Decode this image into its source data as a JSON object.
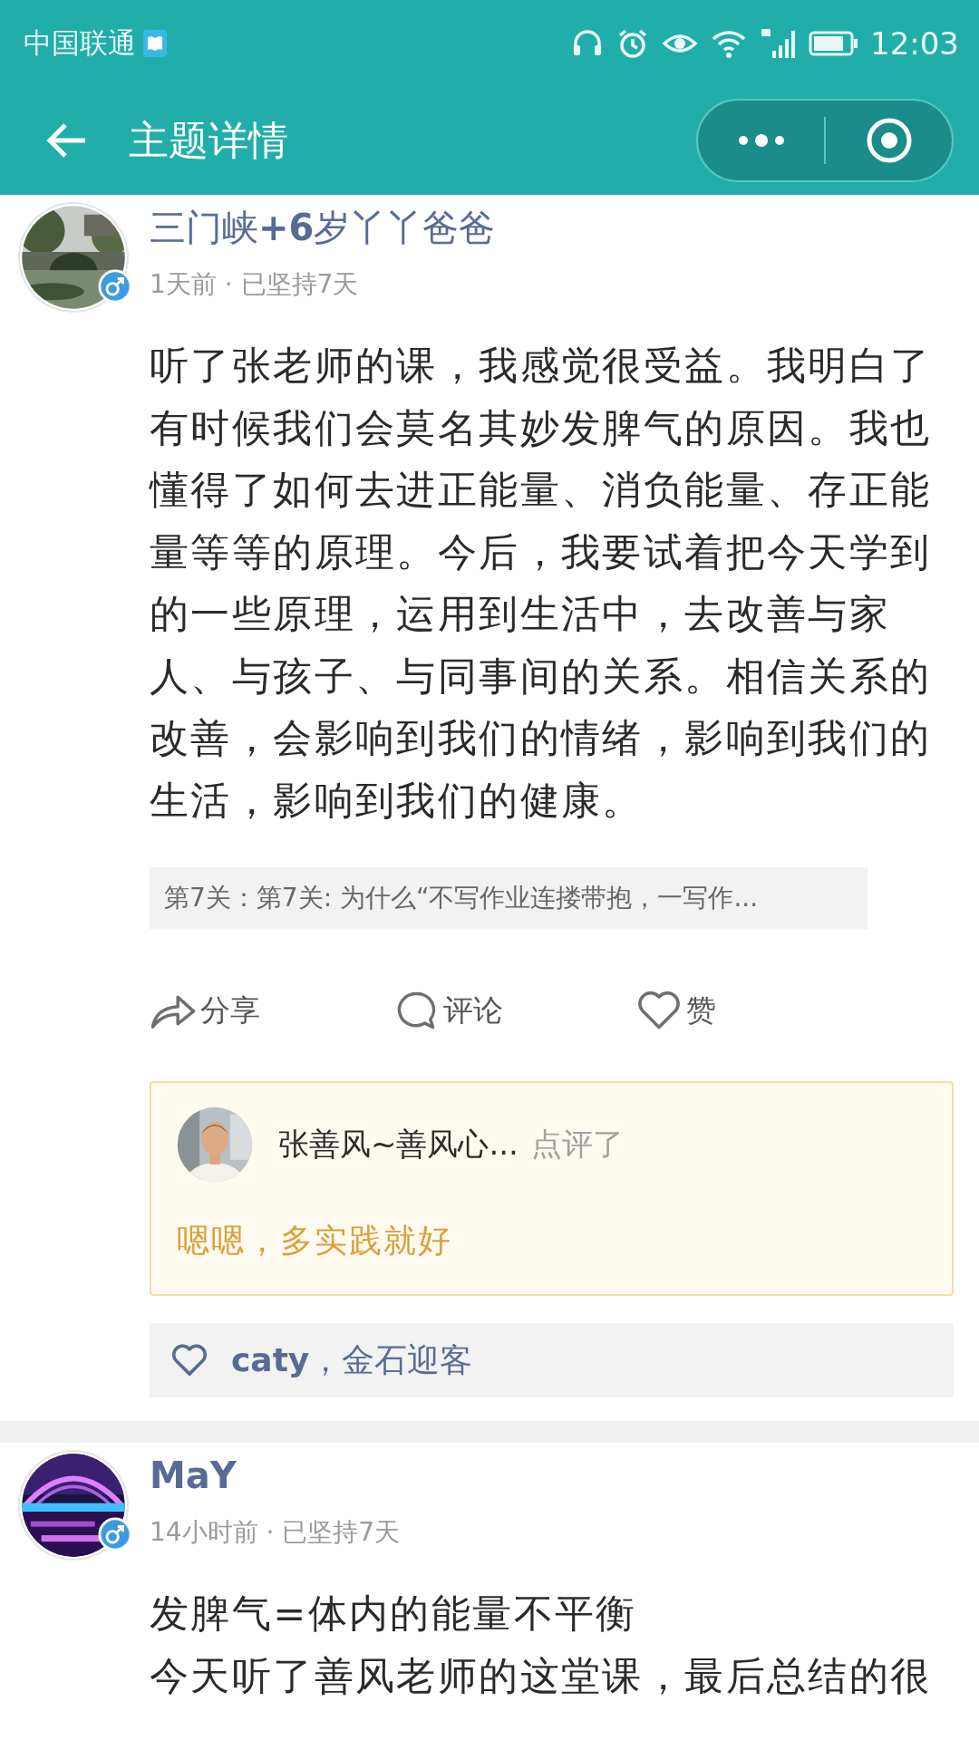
{
  "status_bar": {
    "carrier": "中国联通",
    "time": "12:03"
  },
  "header": {
    "title": "主题详情"
  },
  "posts": [
    {
      "author": "三门峡**+6**岁丫丫爸爸",
      "avatar": {
        "kind": "picture"
      },
      "meta": "1天前 · 已坚持7天",
      "body": [
        "听了张老师的课，我感觉很受益。我明白了有时候我们会莫名其妙发脾气的原因。我也懂得了如何去进正能量、消负能量、存正能量等等的原理。今后，我要试着把今天学到的一些原理，运用到生活中，去改善与家人、与孩子、与同事间的关系。相信关系的改善，会影响到我们的情绪，影响到我们的生活，影响到我们的健康。"
      ],
      "lesson": "第7关：第7关: 为什么“不写作业连搂带抱，一写作...",
      "actions": [
        {
          "kind": "share",
          "label": "分享"
        },
        {
          "kind": "comment",
          "label": "评论"
        },
        {
          "kind": "like",
          "label": "赞"
        }
      ],
      "review": {
        "author": "张善风~善风心...",
        "verb": "点评了",
        "text": "嗯嗯，多实践就好"
      },
      "likes": "**caty**，金石迎客"
    },
    {
      "author": "MaY",
      "avatar": {
        "kind": "picture"
      },
      "meta": "14小时前 · 已坚持7天",
      "body": [
        "发脾气=体内的能量不平衡",
        "今天听了善风老师的这堂课，最后总结的很"
      ]
    }
  ]
}
